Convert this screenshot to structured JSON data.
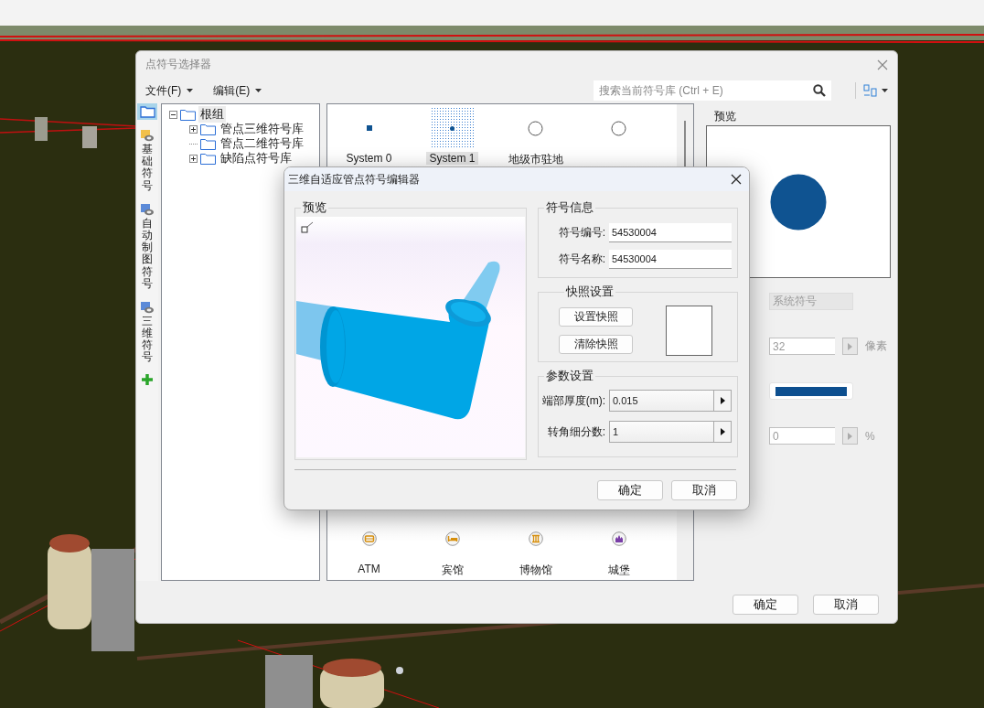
{
  "main_window": {
    "title": "点符号选择器",
    "menus": [
      {
        "label": "文件(F)"
      },
      {
        "label": "编辑(E)"
      }
    ],
    "search": {
      "placeholder": "搜索当前符号库 (Ctrl + E)"
    },
    "side_tabs": [
      {
        "kind": "folder",
        "selected": true
      },
      {
        "kind": "library",
        "label": "基础符号",
        "selected": false
      },
      {
        "kind": "library",
        "label": "自动制图符号",
        "selected": false
      },
      {
        "kind": "library",
        "label": "三维符号",
        "selected": false
      }
    ],
    "tree": {
      "label": "根组",
      "expanded": true,
      "selected": true,
      "children": [
        {
          "label": "管点三维符号库",
          "expanded": false,
          "selected": false
        },
        {
          "label": "管点二维符号库",
          "selected": false
        },
        {
          "label": "缺陷点符号库",
          "expanded": false,
          "selected": false
        }
      ]
    },
    "symbols_top": [
      {
        "kind": "square",
        "label": "System 0",
        "selected": false
      },
      {
        "kind": "dot",
        "label": "System 1",
        "selected": true
      },
      {
        "kind": "circle",
        "label": "地级市驻地",
        "selected": false
      },
      {
        "kind": "circle",
        "selected": false
      }
    ],
    "symbols_bottom": [
      {
        "kind": "atm",
        "label": "ATM",
        "selected": false
      },
      {
        "kind": "hotel",
        "label": "宾馆",
        "selected": false
      },
      {
        "kind": "museum",
        "label": "博物馆",
        "selected": false
      },
      {
        "kind": "castle",
        "label": "城堡",
        "selected": false
      }
    ],
    "preview": {
      "title": "预览"
    },
    "properties": [
      {
        "kind": "text",
        "value": "系统符号",
        "disabled": true
      },
      {
        "kind": "spin",
        "value": "32",
        "unit": "像素",
        "disabled": true
      },
      {
        "kind": "color",
        "color": "#0d4f8f"
      },
      {
        "kind": "spin",
        "value": "0",
        "unit": "%",
        "disabled": true
      }
    ],
    "buttons": [
      "确定",
      "取消"
    ]
  },
  "dialog": {
    "title": "三维自适应管点符号编辑器",
    "preview_title": "预览",
    "info": {
      "title": "符号信息",
      "fields": [
        {
          "label": "符号编号:",
          "value": "54530004"
        },
        {
          "label": "符号名称:",
          "value": "54530004"
        }
      ]
    },
    "snapshot": {
      "title": "快照设置",
      "buttons": [
        "设置快照",
        "清除快照"
      ]
    },
    "params": {
      "title": "参数设置",
      "fields": [
        {
          "label": "端部厚度(m):",
          "value": "0.015"
        },
        {
          "label": "转角细分数:",
          "value": "1"
        }
      ]
    },
    "buttons": [
      "确定",
      "取消"
    ]
  }
}
